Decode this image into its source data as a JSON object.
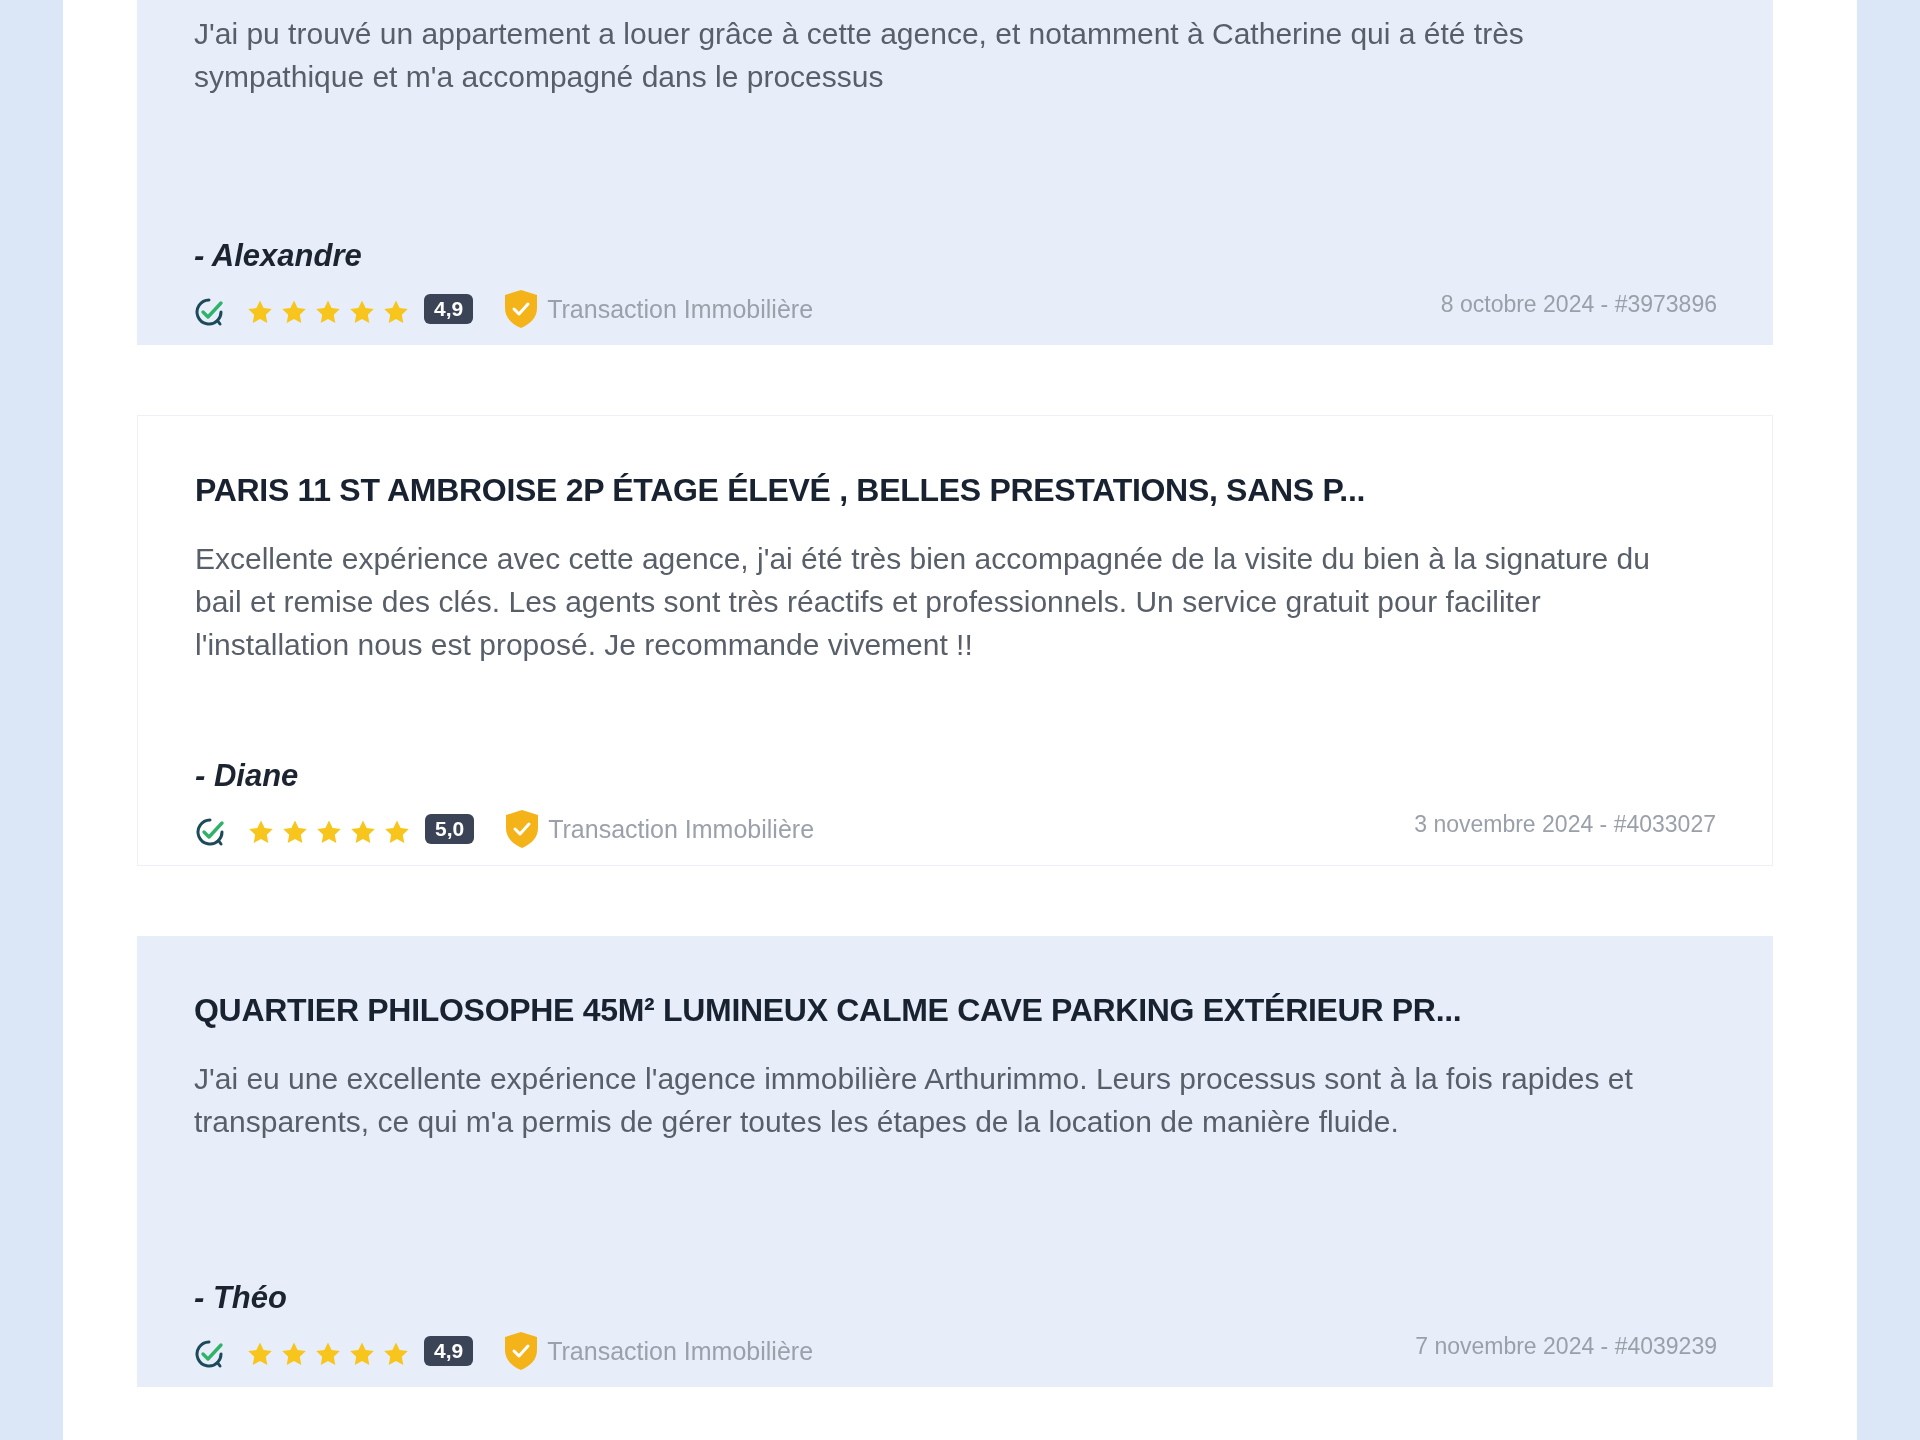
{
  "reviews": [
    {
      "shaded": true,
      "text": "J'ai pu trouvé un appartement a louer grâce à cette agence, et notamment à Catherine qui a été très sympathique et m'a accompagné dans le processus",
      "author": "- Alexandre",
      "verified": true,
      "stars": 5,
      "rating": "4,9",
      "category": "Transaction Immobilière",
      "date": "8 octobre 2024 - #3973896"
    },
    {
      "shaded": false,
      "title": "PARIS 11 ST AMBROISE 2P ÉTAGE ÉLEVÉ , BELLES PRESTATIONS, SANS P...",
      "text": "Excellente expérience avec cette agence, j'ai été très bien accompagnée de la visite du bien à la signature du bail et remise des clés. Les agents sont très réactifs et professionnels. Un service gratuit pour faciliter l'installation nous est proposé. Je recommande vivement !!",
      "author": "- Diane",
      "verified": true,
      "stars": 5,
      "rating": "5,0",
      "category": "Transaction Immobilière",
      "date": "3 novembre 2024 - #4033027"
    },
    {
      "shaded": true,
      "title": "QUARTIER PHILOSOPHE 45M² LUMINEUX CALME CAVE PARKING EXTÉRIEUR PR...",
      "text": "J'ai eu une excellente expérience l'agence immobilière Arthurimmo. Leurs processus sont à la fois rapides et transparents, ce qui m'a permis de gérer toutes les étapes de la location de manière fluide.",
      "author": "- Théo",
      "verified": true,
      "stars": 5,
      "rating": "4,9",
      "category": "Transaction Immobilière",
      "date": "7 novembre 2024 - #4039239"
    }
  ]
}
